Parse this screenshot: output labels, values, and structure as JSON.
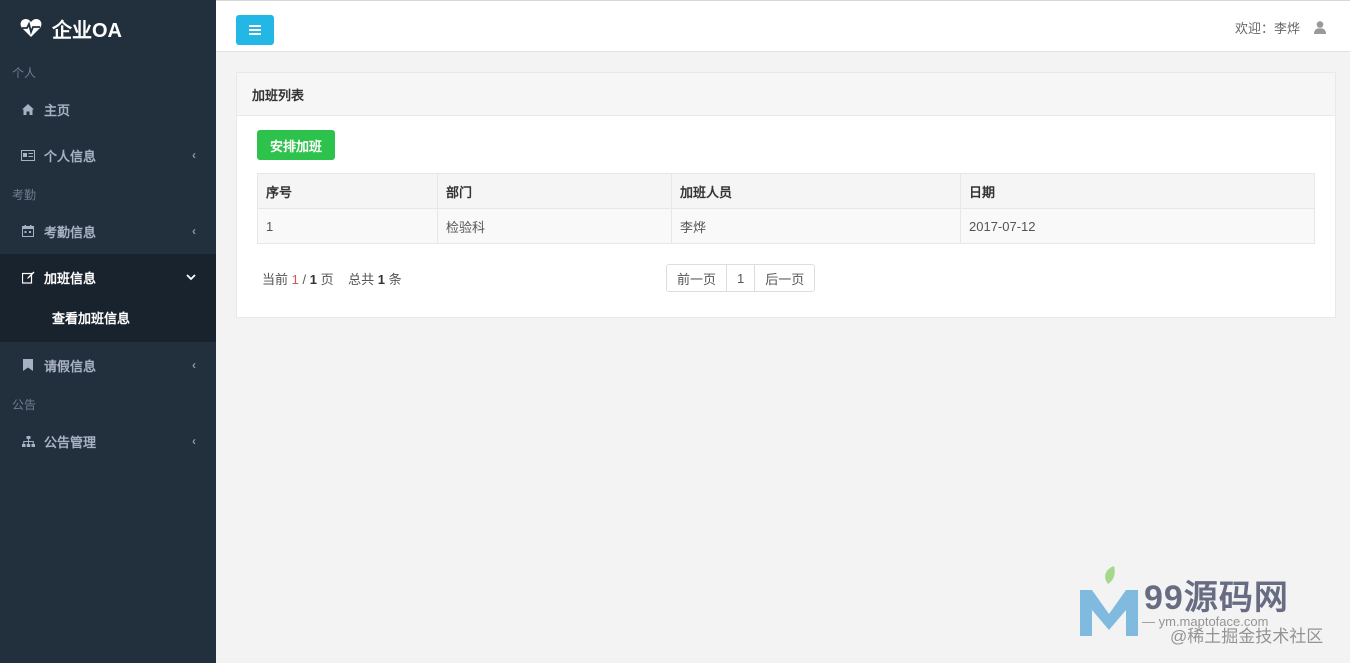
{
  "app": {
    "title": "企业OA"
  },
  "sidebar": {
    "sections": [
      {
        "label": "个人"
      },
      {
        "label": "考勤"
      },
      {
        "label": "公告"
      }
    ],
    "items": [
      {
        "label": "主页",
        "icon": "home-icon"
      },
      {
        "label": "个人信息",
        "icon": "id-card-icon"
      },
      {
        "label": "考勤信息",
        "icon": "calendar-icon"
      },
      {
        "label": "加班信息",
        "icon": "edit-icon"
      },
      {
        "label": "请假信息",
        "icon": "bookmark-icon"
      },
      {
        "label": "公告管理",
        "icon": "sitemap-icon"
      }
    ],
    "submenu": {
      "label": "查看加班信息"
    }
  },
  "topbar": {
    "welcome": "欢迎：李烨"
  },
  "panel": {
    "title": "加班列表",
    "add_button": "安排加班",
    "table": {
      "headers": [
        "序号",
        "部门",
        "加班人员",
        "日期"
      ],
      "rows": [
        [
          "1",
          "检验科",
          "李烨",
          "2017-07-12"
        ]
      ]
    },
    "pager": {
      "prefix": "当前",
      "current": "1",
      "sep": "/",
      "total_pages": "1",
      "page_word": "页",
      "total_prefix": "总共",
      "total_count": "1",
      "count_word": "条",
      "prev": "前一页",
      "page1": "1",
      "next": "后一页"
    }
  },
  "watermark": {
    "title": "99源码网",
    "subtitle": "— ym.maptoface.com",
    "subtitle2": "@稀土掘金技术社区"
  },
  "colors": {
    "sidebar_bg": "#22303e",
    "menu_button": "#23b7e5",
    "add_button": "#2dc24b",
    "current_page": "#d9534f"
  }
}
